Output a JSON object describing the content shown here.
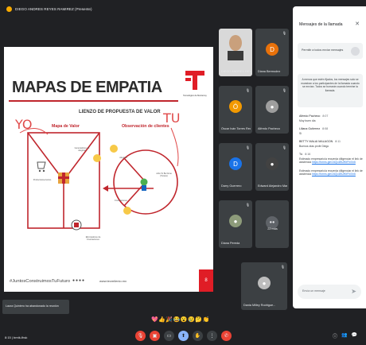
{
  "presenter": "DIEGO ANDRES REYES RAMIREZ (Presente)",
  "slide": {
    "title": "MAPAS DE EMPATIA",
    "canvas_title": "LIENZO DE PROPUESTA DE VALOR",
    "left_label": "Mapa de Valor",
    "right_label": "Observación de clientes",
    "hand_yo": "YO",
    "hand_tu": "TU",
    "logo_caption": "Tecnológico de Monterrey",
    "small_labels": [
      "Generadores de Alegrías",
      "Productos/servicios",
      "Eliminadores de Frustraciones",
      "Alegrías",
      "Frustraciones",
      "Jobs To Be Done (Tareas)"
    ],
    "hashtag": "#JuntosConstruimosTuFuturo",
    "site": "www.tecmilenio.mx",
    "page_number": "8"
  },
  "participants": [
    {
      "name": "DIEGO ANDRES REYE...",
      "type": "video"
    },
    {
      "name": "Diana Bermudez",
      "initial": "D",
      "color": "#e8710a"
    },
    {
      "name": "Óscar Iván Torres Red...",
      "initial": "Ó",
      "color": "#f29900"
    },
    {
      "name": "Alfredo Pacheco",
      "type": "photo"
    },
    {
      "name": "Darry Guerrero",
      "initial": "D",
      "color": "#1a73e8"
    },
    {
      "name": "Edward Alejandro Mar...",
      "type": "photo"
    },
    {
      "name": "Diana Pereda",
      "type": "photo"
    },
    {
      "name": "22 más",
      "type": "more"
    },
    {
      "name": "Dania Milley Rodrigue...",
      "type": "photo"
    }
  ],
  "chat": {
    "header": "Mensajes de la llamada",
    "toggle_label": "Permitir a todos enviar mensajes",
    "notice": "A menos que estén fijados, los mensajes solo se muestran a los participantes de la llamada cuando se envían. Todos se borrarán cuando termine la llamada.",
    "messages": [
      {
        "from": "Alfredo Pacheco",
        "time": "8:07",
        "text": "Muy buen día"
      },
      {
        "from": "Liliana Gutierrez",
        "time": "8:08",
        "text": "Si"
      },
      {
        "from": "BETTY MALAI MALAGON",
        "time": "8:11",
        "text": "Buenos días profe Diego"
      },
      {
        "from": "Tú",
        "time": "8:16",
        "text": "Estimado empresario/a recuerda diligenciar el link de asistencia",
        "link": "https://forms.gle/2dQL6BUfKtFhiXn6"
      },
      {
        "from": "",
        "time": "",
        "text": "Estimado empresario/a recuerda diligenciar el link de asistencia",
        "link": "https://forms.gle/2dQL6BUfKtFhiXn6"
      }
    ],
    "input_placeholder": "Envía un mensaje"
  },
  "toast": "Laura Quintero ha abandonado la reunión",
  "reactions": "💖👍🎉😂😮😢🤔👏",
  "bottom_left": "8:15 | bmtk-fhsk",
  "colors": {
    "accent_red": "#c0262d",
    "meet_red": "#ea4335",
    "panel_bg": "#ffffff",
    "app_bg": "#202124"
  }
}
